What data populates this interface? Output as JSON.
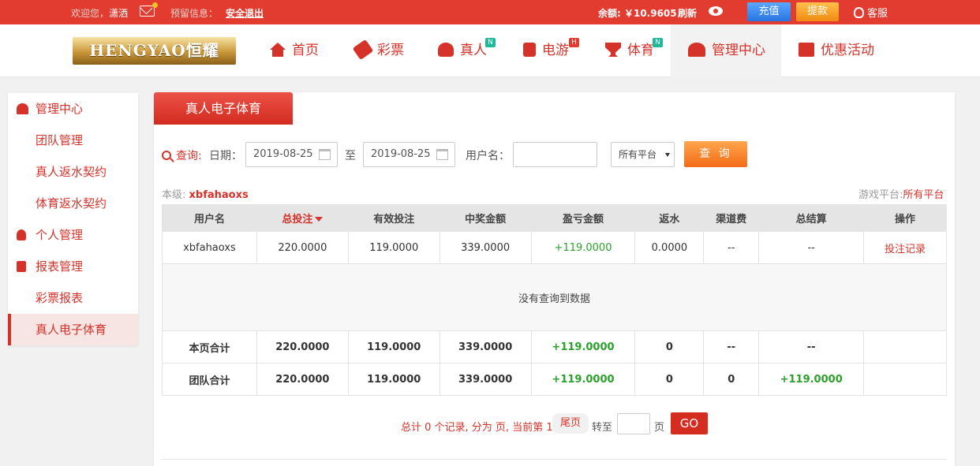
{
  "topbar": {
    "welcome": "欢迎您，",
    "username": "潇洒",
    "notice_label": "预留信息：",
    "logout": "安全退出",
    "balance": "余额: ￥10.9605",
    "refresh": "刷新",
    "deposit": "充值",
    "withdraw": "提款",
    "service": "客服"
  },
  "nav": {
    "logo": "HENGYAO恒耀",
    "items": [
      {
        "label": "首页",
        "icon": "home-icon"
      },
      {
        "label": "彩票",
        "icon": "ticket-icon"
      },
      {
        "label": "真人",
        "icon": "person-icon",
        "badge": "N",
        "badge_color": "#1fb89a"
      },
      {
        "label": "电游",
        "icon": "game-icon",
        "badge": "H",
        "badge_color": "#e23b2f"
      },
      {
        "label": "体育",
        "icon": "trophy-icon",
        "badge": "N",
        "badge_color": "#1fb89a"
      },
      {
        "label": "管理中心",
        "icon": "team-icon"
      },
      {
        "label": "优惠活动",
        "icon": "gift-icon"
      }
    ]
  },
  "sidebar": {
    "items": [
      {
        "label": "管理中心",
        "type": "group",
        "icon": "team-icon"
      },
      {
        "label": "团队管理",
        "type": "sub"
      },
      {
        "label": "真人返水契约",
        "type": "sub"
      },
      {
        "label": "体育返水契约",
        "type": "sub"
      },
      {
        "label": "个人管理",
        "type": "group",
        "icon": "person-icon"
      },
      {
        "label": "报表管理",
        "type": "group",
        "icon": "report-icon"
      },
      {
        "label": "彩票报表",
        "type": "sub"
      },
      {
        "label": "真人电子体育",
        "type": "sub",
        "active": true
      }
    ]
  },
  "main": {
    "tab": "真人电子体育",
    "query": {
      "search_label": "查询:",
      "date_label": "日期：",
      "start_date": "2019-08-25",
      "to_label": "至",
      "end_date": "2019-08-25",
      "user_label": "用户名：",
      "user_value": "",
      "platform": "所有平台",
      "query_button": "查 询"
    },
    "level_label": "本级:",
    "level_user": "xbfahaoxs",
    "platform_label": "游戏平台:",
    "platform_value": "所有平台",
    "table": {
      "headers": [
        "用户名",
        "总投注",
        "有效投注",
        "中奖金额",
        "盈亏金额",
        "返水",
        "渠道费",
        "总结算",
        "操作"
      ],
      "data_row": [
        "xbfahaoxs",
        "220.0000",
        "119.0000",
        "339.0000",
        "+119.0000",
        "0.0000",
        "--",
        "--",
        "投注记录"
      ],
      "empty_text": "没有查询到数据",
      "page_total": [
        "本页合计",
        "220.0000",
        "119.0000",
        "339.0000",
        "+119.0000",
        "0",
        "--",
        "--",
        ""
      ],
      "team_total": [
        "团队合计",
        "220.0000",
        "119.0000",
        "339.0000",
        "+119.0000",
        "0",
        "0",
        "+119.0000",
        ""
      ]
    },
    "pager": {
      "summary": "总计 0 个记录, 分为 页, 当前第 1 页",
      "last": "尾页",
      "goto": "转至",
      "page": "页",
      "go": "GO"
    }
  }
}
